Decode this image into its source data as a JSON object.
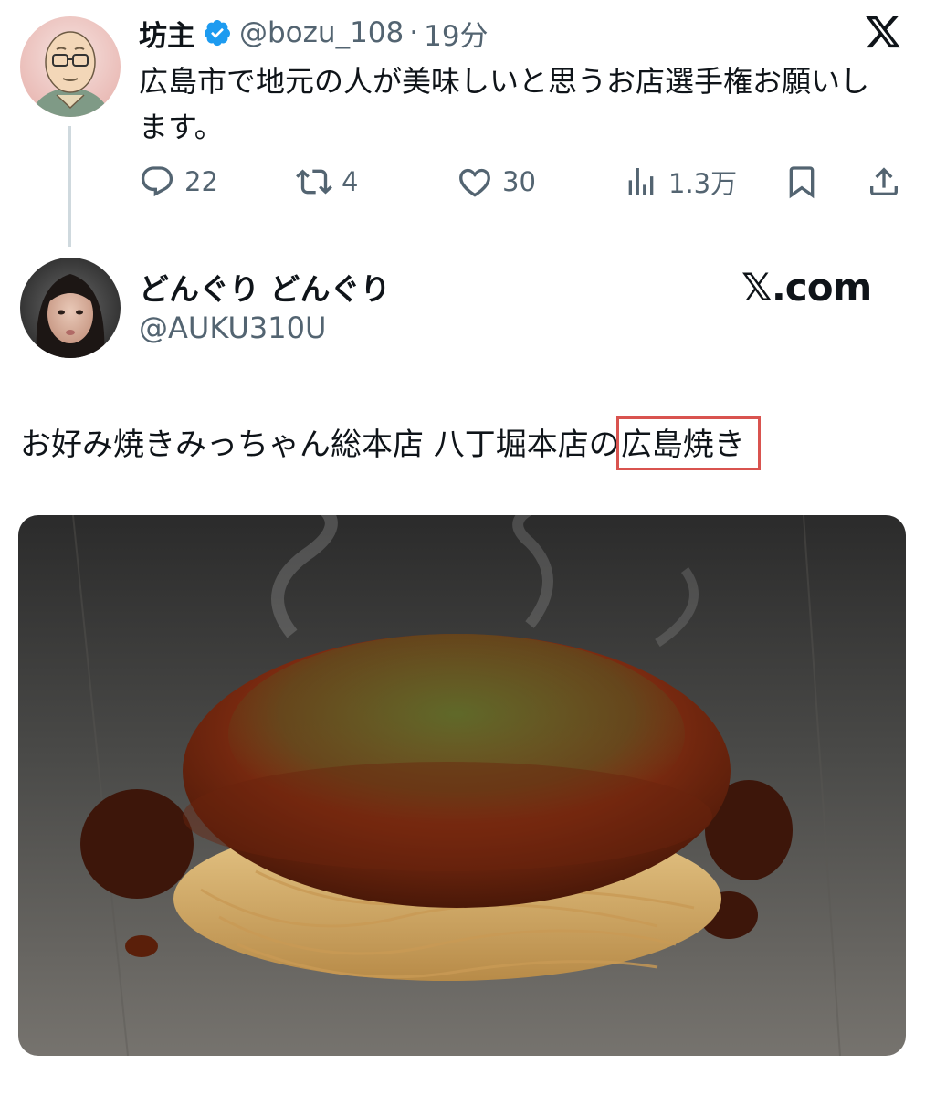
{
  "tweet": {
    "name": "坊主",
    "handle": "@bozu_108",
    "separator": "·",
    "time": "19分",
    "text": "広島市で地元の人が美味しいと思うお店選手権お願いします。",
    "replies": "22",
    "retweets": "4",
    "likes": "30",
    "views": "1.3万",
    "icons": {
      "verified": "verified-badge-icon",
      "platform": "x-logo-icon",
      "reply": "reply-icon",
      "retweet": "retweet-icon",
      "like": "heart-icon",
      "views": "views-chart-icon",
      "bookmark": "bookmark-icon",
      "share": "share-icon"
    },
    "accent": "#1d9bf0"
  },
  "reply": {
    "name": "どんぐり どんぐり",
    "handle": "@AUKU310U",
    "watermark": "𝕏.com",
    "text_plain": "お好み焼きみっちゃん総本店 八丁堀本店の",
    "text_highlight": "広島焼き",
    "highlight_color": "#d9534f",
    "photo": "okonomiyaki-photo"
  }
}
